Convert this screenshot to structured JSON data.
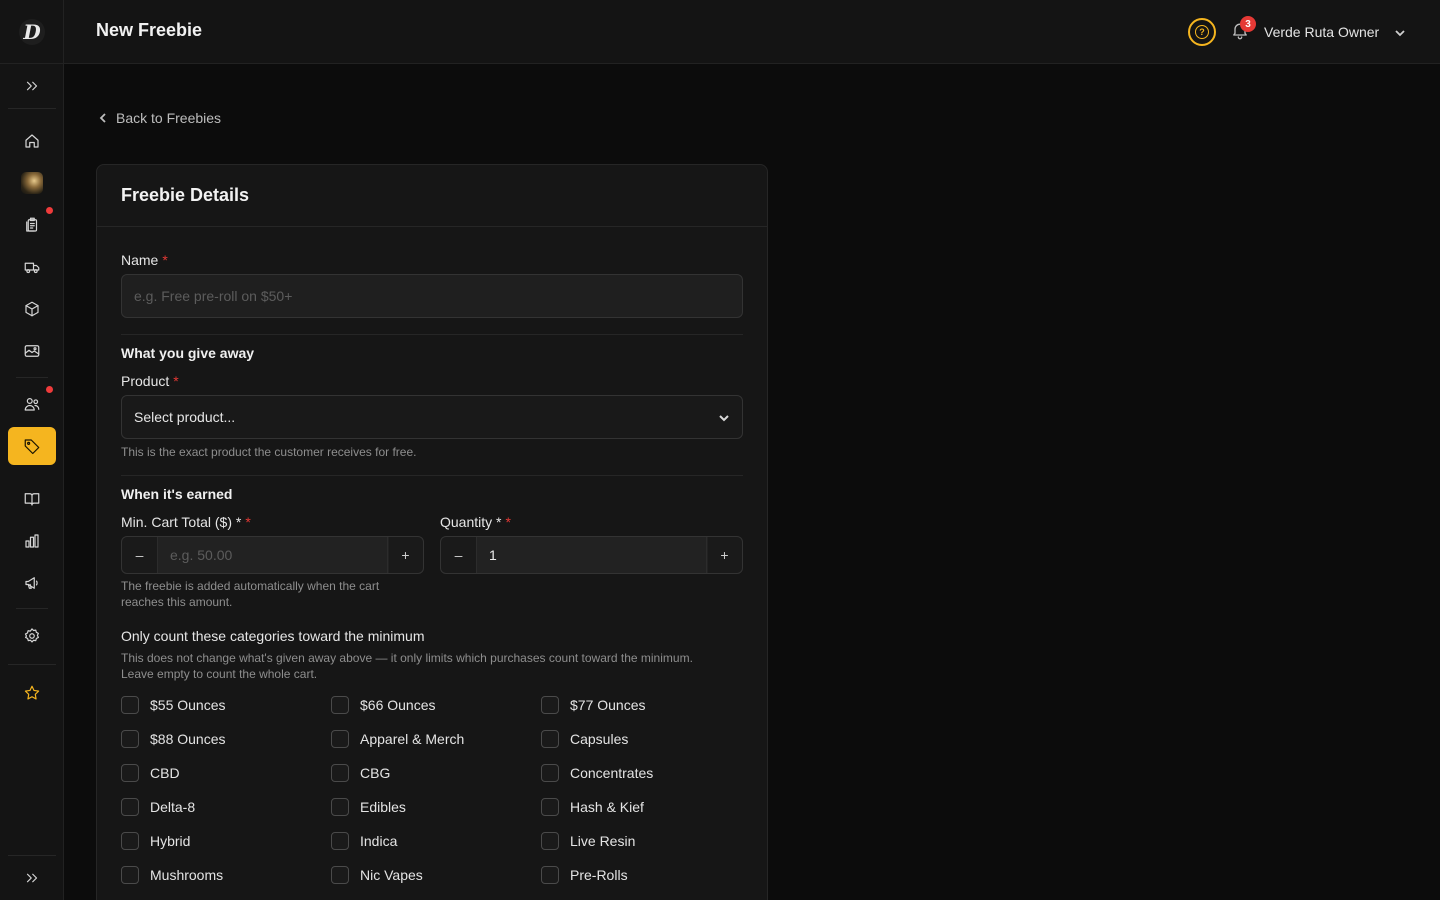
{
  "app": {
    "logo_letter": "D"
  },
  "header": {
    "title": "New Freebie",
    "notification_count": "3",
    "user_name": "Verde Ruta Owner"
  },
  "back_link": "Back to Freebies",
  "card": {
    "title": "Freebie Details",
    "name": {
      "label": "Name",
      "placeholder": "e.g. Free pre-roll on $50+"
    },
    "give_away": {
      "title": "What you give away",
      "product_label": "Product",
      "product_value": "Select product...",
      "product_hint": "This is the exact product the customer receives for free."
    },
    "earned": {
      "title": "When it's earned",
      "min_cart_label": "Min. Cart Total ($) *",
      "min_cart_placeholder": "e.g. 50.00",
      "min_cart_hint_1": "The freebie is added automatically when the cart",
      "min_cart_hint_2": "reaches this amount.",
      "quantity_label": "Quantity *",
      "quantity_value": "1",
      "minus": "–",
      "plus": "+"
    },
    "categories": {
      "title": "Only count these categories toward the minimum",
      "hint_1": "This does not change what's given away above — it only limits which purchases count toward the minimum.",
      "hint_2": "Leave empty to count the whole cart.",
      "items": [
        "$55 Ounces",
        "$66 Ounces",
        "$77 Ounces",
        "$88 Ounces",
        "Apparel & Merch",
        "Capsules",
        "CBD",
        "CBG",
        "Concentrates",
        "Delta-8",
        "Edibles",
        "Hash & Kief",
        "Hybrid",
        "Indica",
        "Live Resin",
        "Mushrooms",
        "Nic Vapes",
        "Pre-Rolls"
      ]
    }
  },
  "required_mark": "*",
  "colors": {
    "accent": "#f5b51f",
    "danger": "#e53935",
    "background": "#0c0c0c",
    "surface": "#161616"
  }
}
